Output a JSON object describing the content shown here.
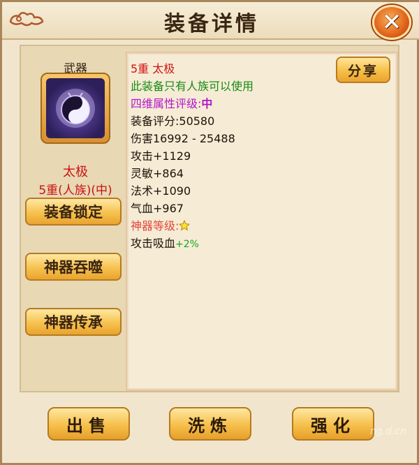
{
  "window": {
    "title": "装备详情",
    "close_glyph": "✕"
  },
  "item": {
    "slot_label": "武器",
    "name": "太极",
    "grade": "5重(人族)(中)",
    "icon": "taiji-weapon-icon"
  },
  "side_buttons": {
    "lock": "装备锁定",
    "devour": "神器吞噬",
    "inherit": "神器传承"
  },
  "share_label": "分享",
  "details": {
    "header": "5重  太极",
    "restriction": "此装备只有人族可以使用",
    "rating_label": "四维属性评级:",
    "rating_value": "中",
    "score": "装备评分:50580",
    "damage": "伤害16992 - 25488",
    "attack": "攻击+1129",
    "agility": "灵敏+864",
    "magic": "法术+1090",
    "hp": "气血+967",
    "artifact_level_label": "神器等级:",
    "artifact_level_stars": 1,
    "lifesteal_label": "攻击吸血",
    "lifesteal_value": "+2%"
  },
  "bottom_buttons": {
    "sell": "出售",
    "refine": "洗炼",
    "enhance": "强化"
  },
  "watermark": "ng.d.cn",
  "colors": {
    "red": "#d41313",
    "green": "#178a14",
    "purple": "#b214c8",
    "button_gold": "#f6bf48"
  }
}
